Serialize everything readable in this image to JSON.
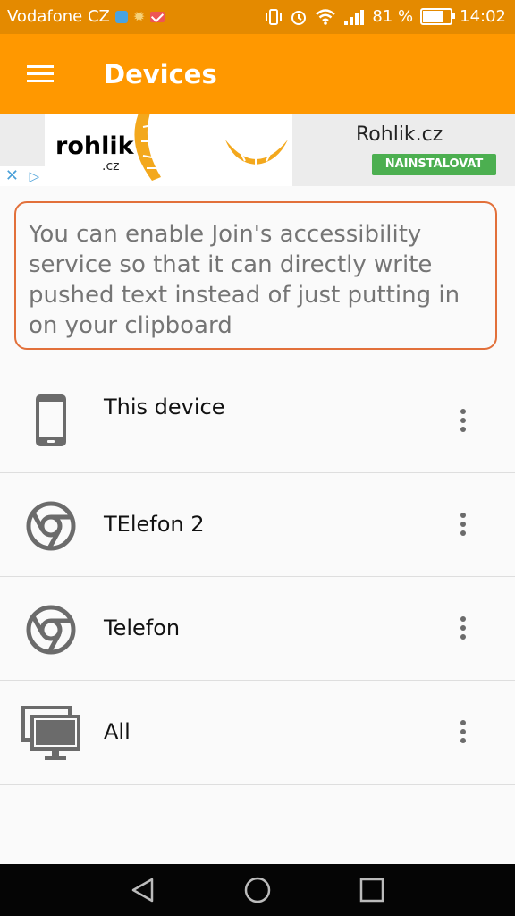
{
  "status_bar": {
    "carrier": "Vodafone CZ",
    "battery_percent": "81 %",
    "battery_level": 0.81,
    "time": "14:02",
    "icons": [
      "chat-icon",
      "brightness-icon",
      "mail-icon",
      "vibrate-icon",
      "alarm-icon",
      "wifi-icon",
      "signal-icon",
      "battery-icon"
    ]
  },
  "app_bar": {
    "title": "Devices",
    "menu_icon": "hamburger-menu-icon"
  },
  "ad": {
    "logo_text": "rohlik",
    "logo_sub": ".cz",
    "title": "Rohlik.cz",
    "install_label": "NAINSTALOVAT",
    "install_color": "#4caf50"
  },
  "notice": {
    "text": "You can enable Join's accessibility service so that it can directly write pushed text instead of just putting in on your clipboard",
    "border_color": "#e2703a"
  },
  "devices": [
    {
      "name": "This device",
      "icon": "smartphone-icon"
    },
    {
      "name": "TElefon 2",
      "icon": "chrome-icon"
    },
    {
      "name": "Telefon",
      "icon": "chrome-icon"
    },
    {
      "name": "All",
      "icon": "monitors-icon"
    }
  ],
  "colors": {
    "app_bar": "#ff9800",
    "status_bar": "#e48a00"
  },
  "nav_bar": {
    "icons": [
      "back-icon",
      "home-icon",
      "recents-icon"
    ]
  }
}
